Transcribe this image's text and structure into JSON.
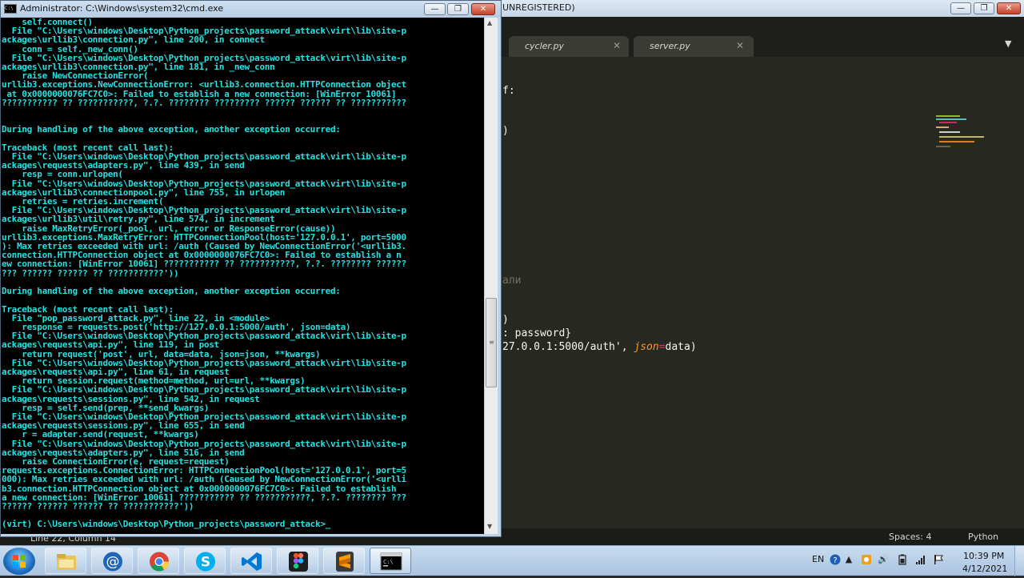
{
  "sublime": {
    "title": "UNREGISTERED)",
    "tabs": [
      {
        "label": "cycler.py"
      },
      {
        "label": "server.py"
      }
    ],
    "tab_close": "✕",
    "tab_dropdown": "▼",
    "code_lines": {
      "line1": "f:",
      "line2": ")",
      "line3": "али",
      "line4": ")",
      "line5": ": password}",
      "line6_a": "27.0.0.1:5000/auth', ",
      "line6_kw": "json",
      "line6_eq": "=",
      "line6_b": "data)"
    },
    "status": {
      "position": "Line 22, Column 14",
      "spaces": "Spaces: 4",
      "syntax": "Python"
    }
  },
  "cmd": {
    "title": "Administrator: C:\\Windows\\system32\\cmd.exe",
    "icon_text": "C:\\",
    "output": "    self.connect()\n  File \"C:\\Users\\windows\\Desktop\\Python_projects\\password_attack\\virt\\lib\\site-p\nackages\\urllib3\\connection.py\", line 200, in connect\n    conn = self._new_conn()\n  File \"C:\\Users\\windows\\Desktop\\Python_projects\\password_attack\\virt\\lib\\site-p\nackages\\urllib3\\connection.py\", line 181, in _new_conn\n    raise NewConnectionError(\nurllib3.exceptions.NewConnectionError: <urllib3.connection.HTTPConnection object\n at 0x0000000076FC7C0>: Failed to establish a new connection: [WinError 10061]\n??????????? ?? ???????????, ?.?. ???????? ????????? ?????? ?????? ?? ???????????\n\n\nDuring handling of the above exception, another exception occurred:\n\nTraceback (most recent call last):\n  File \"C:\\Users\\windows\\Desktop\\Python_projects\\password_attack\\virt\\lib\\site-p\nackages\\requests\\adapters.py\", line 439, in send\n    resp = conn.urlopen(\n  File \"C:\\Users\\windows\\Desktop\\Python_projects\\password_attack\\virt\\lib\\site-p\nackages\\urllib3\\connectionpool.py\", line 755, in urlopen\n    retries = retries.increment(\n  File \"C:\\Users\\windows\\Desktop\\Python_projects\\password_attack\\virt\\lib\\site-p\nackages\\urllib3\\util\\retry.py\", line 574, in increment\n    raise MaxRetryError(_pool, url, error or ResponseError(cause))\nurllib3.exceptions.MaxRetryError: HTTPConnectionPool(host='127.0.0.1', port=5000\n): Max retries exceeded with url: /auth (Caused by NewConnectionError('<urllib3.\nconnection.HTTPConnection object at 0x0000000076FC7C0>: Failed to establish a n\new connection: [WinError 10061] ??????????? ?? ???????????, ?.?. ???????? ??????\n??? ?????? ?????? ?? ???????????'))\n\nDuring handling of the above exception, another exception occurred:\n\nTraceback (most recent call last):\n  File \"pop_password_attack.py\", line 22, in <module>\n    response = requests.post('http://127.0.0.1:5000/auth', json=data)\n  File \"C:\\Users\\windows\\Desktop\\Python_projects\\password_attack\\virt\\lib\\site-p\nackages\\requests\\api.py\", line 119, in post\n    return request('post', url, data=data, json=json, **kwargs)\n  File \"C:\\Users\\windows\\Desktop\\Python_projects\\password_attack\\virt\\lib\\site-p\nackages\\requests\\api.py\", line 61, in request\n    return session.request(method=method, url=url, **kwargs)\n  File \"C:\\Users\\windows\\Desktop\\Python_projects\\password_attack\\virt\\lib\\site-p\nackages\\requests\\sessions.py\", line 542, in request\n    resp = self.send(prep, **send_kwargs)\n  File \"C:\\Users\\windows\\Desktop\\Python_projects\\password_attack\\virt\\lib\\site-p\nackages\\requests\\sessions.py\", line 655, in send\n    r = adapter.send(request, **kwargs)\n  File \"C:\\Users\\windows\\Desktop\\Python_projects\\password_attack\\virt\\lib\\site-p\nackages\\requests\\adapters.py\", line 516, in send\n    raise ConnectionError(e, request=request)\nrequests.exceptions.ConnectionError: HTTPConnectionPool(host='127.0.0.1', port=5\n000): Max retries exceeded with url: /auth (Caused by NewConnectionError('<urlli\nb3.connection.HTTPConnection object at 0x0000000076FC7C0>: Failed to establish\na new connection: [WinError 10061] ??????????? ?? ???????????, ?.?. ???????? ???\n?????? ?????? ?????? ?? ???????????'))\n\n(virt) C:\\Users\\windows\\Desktop\\Python_projects\\password_attack>_"
  },
  "window_buttons": {
    "minimize": "—",
    "maximize": "❐",
    "close": "✕"
  },
  "taskbar": {
    "items": [
      {
        "icon": "windows-explorer-icon"
      },
      {
        "icon": "email-at-icon"
      },
      {
        "icon": "chrome-icon"
      },
      {
        "icon": "skype-icon"
      },
      {
        "icon": "vscode-icon"
      },
      {
        "icon": "figma-icon"
      },
      {
        "icon": "sublime-text-icon"
      },
      {
        "icon": "cmd-icon"
      }
    ],
    "language": "EN",
    "clock_time": "10:39 PM",
    "clock_date": "4/12/2021"
  },
  "colors": {
    "console_text": "#28e0e0",
    "editor_bg": "#272822",
    "keyword_orange": "#fd971f",
    "operator_pink": "#f92672"
  }
}
